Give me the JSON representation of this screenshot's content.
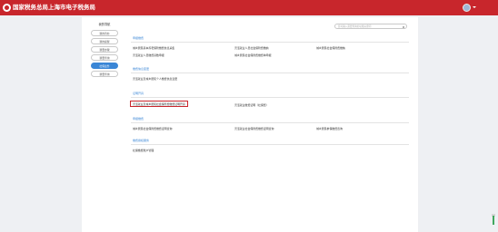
{
  "header": {
    "title": "国家税务总局上海市电子税务局"
  },
  "sidebar": {
    "title": "我的导航",
    "items": [
      {
        "label": "我的待办"
      },
      {
        "label": "我的提醒"
      },
      {
        "label": "我要办税"
      },
      {
        "label": "我要查询"
      },
      {
        "label": "社保业务"
      },
      {
        "label": "我要查询"
      }
    ]
  },
  "search": {
    "placeholder": "您可输入需要查询的功能关键词"
  },
  "sections": {
    "s1": {
      "title": "申报缴费",
      "links": [
        "城乡居民基本养老保险缴费信息采集",
        "灵活就业人员社会保险费缴纳",
        "城乡居民社会保险费缴纳",
        "灵活就业人员缴费基数申报",
        "城乡居民社会保险费缴费单申报"
      ]
    },
    "s2": {
      "title": "缴费信息变更",
      "links": [
        "灵活就业及城乡居民个人缴费信息变更"
      ]
    },
    "s3": {
      "title": "证明开具",
      "links": [
        "灵活就业及城乡居民社会保险费缴费证明开具",
        "灵活就业缴费证明（社保费）"
      ]
    },
    "s4": {
      "title": "申报缴费",
      "links": [
        "城乡居民社会保险费缴费证明查询",
        "灵活就业社会保险费缴费证明查询",
        "城乡居民参保缴费查询"
      ]
    },
    "s5": {
      "title": "缴费授权服务",
      "links": [
        "社保缴费账户管理"
      ]
    }
  }
}
